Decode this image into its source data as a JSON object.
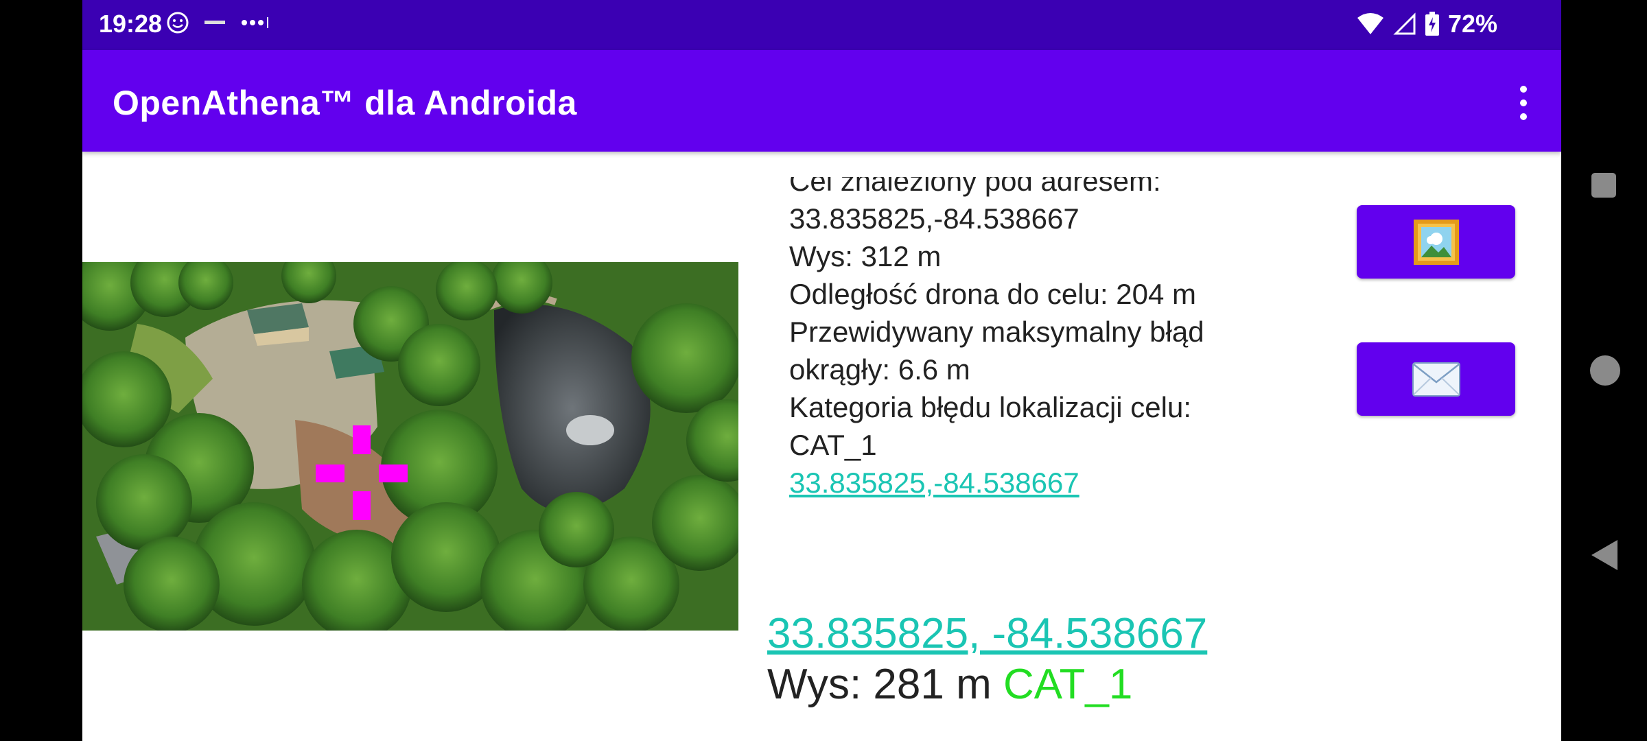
{
  "status_bar": {
    "time": "19:28",
    "notification_icons": [
      "smiley-notification-icon",
      "wyze-icon",
      "more-notifications-icon"
    ],
    "right_icons": [
      "wifi-icon",
      "cell-signal-icon",
      "battery-charging-icon"
    ],
    "battery_percent": "72%"
  },
  "app_bar": {
    "title": "OpenAthena™ dla Androida",
    "overflow_icon": "more-vert-icon"
  },
  "photo": {
    "description_icon": "drone-aerial-image",
    "reticle_color": "#ff00ff"
  },
  "result": {
    "line1": "Cel znaleziony pod adresem:",
    "line2": "33.835825,-84.538667",
    "line3": "Wys: 312 m",
    "line4": "Odległość drona do celu: 204 m",
    "line5": "Przewidywany maksymalny błąd",
    "line6": "okrągły: 6.6 m",
    "line7": "Kategoria błędu lokalizacji celu:",
    "line8": "CAT_1",
    "link": "33.835825,-84.538667"
  },
  "buttons": {
    "image_button_icon": "framed-picture-icon",
    "email_button_icon": "envelope-icon"
  },
  "bottom": {
    "coords": "33.835825, -84.538667",
    "alt_label": "Wys: 281 m",
    "category": "CAT_1"
  },
  "nav_bar": {
    "icons": [
      "recents-square-icon",
      "home-circle-icon",
      "back-triangle-icon"
    ]
  },
  "colors": {
    "status_bar": "#3b00b3",
    "app_bar": "#6200ee",
    "link": "#1ac5b3",
    "category": "#22dd22"
  }
}
